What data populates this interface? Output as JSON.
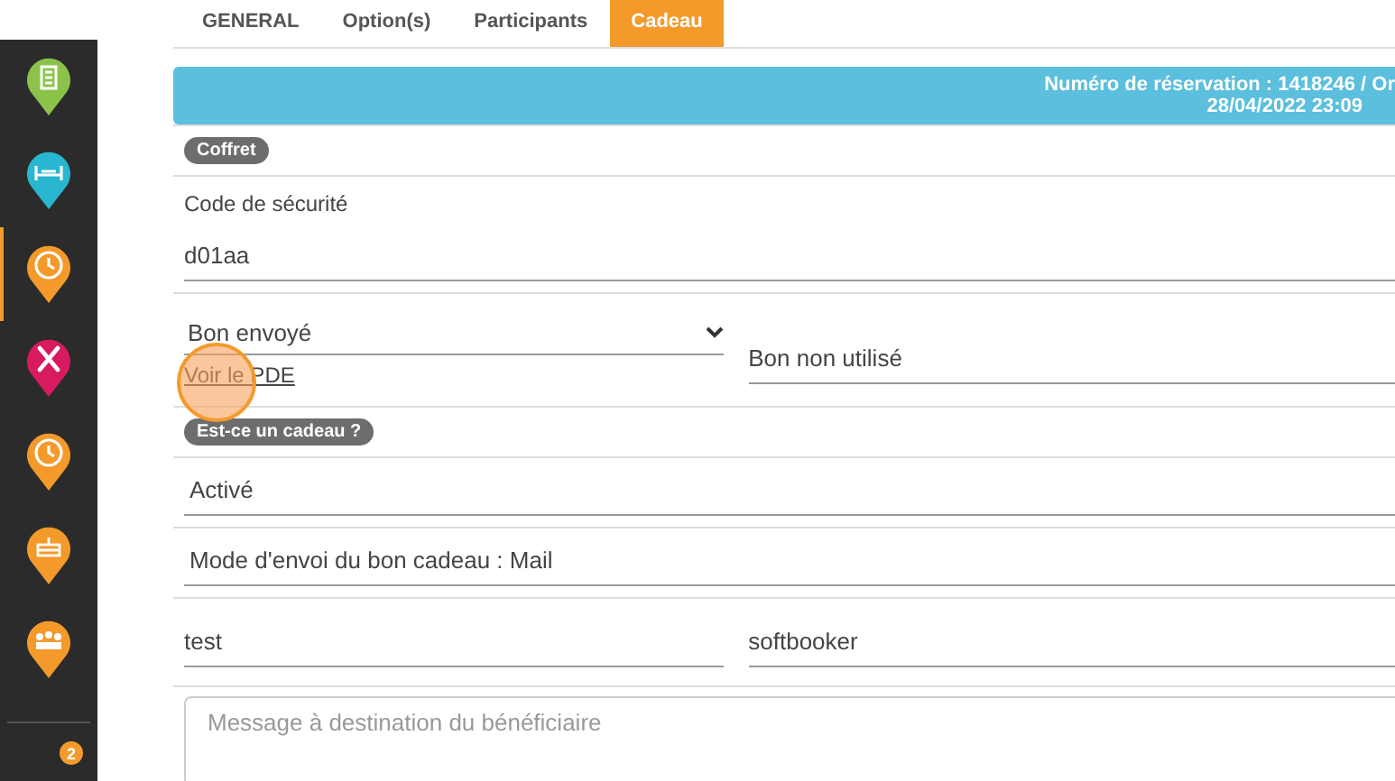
{
  "sidebar": {
    "items": [
      {
        "kind": "building",
        "color": "#8bc34a",
        "selected": false
      },
      {
        "kind": "bed",
        "color": "#29b6d0",
        "selected": false
      },
      {
        "kind": "clock",
        "color": "#f39a2b",
        "selected": true
      },
      {
        "kind": "cutlery",
        "color": "#d81b60",
        "selected": false
      },
      {
        "kind": "clock",
        "color": "#f39a2b",
        "selected": false
      },
      {
        "kind": "cake",
        "color": "#f39a2b",
        "selected": false
      },
      {
        "kind": "group",
        "color": "#f39a2b",
        "selected": false
      }
    ],
    "badge": "2"
  },
  "tabs": [
    {
      "label": "GENERAL",
      "selected": false
    },
    {
      "label": "Option(s)",
      "selected": false
    },
    {
      "label": "Participants",
      "selected": false
    },
    {
      "label": "Cadeau",
      "selected": true
    }
  ],
  "banner": {
    "line_1": "Numéro de réservation : 1418246 / Or",
    "line_2": "28/04/2022 23:09"
  },
  "coffret": {
    "tag": "Coffret",
    "security_label": "Code de sécurité",
    "security_value": "d01aa",
    "status_select": "Bon envoyé",
    "pdf_link": "Voir le PDE",
    "usage_value": "Bon non utilisé"
  },
  "gift": {
    "tag": "Est-ce un cadeau ?",
    "state_value": "Activé",
    "mode_value": "Mode d'envoi du bon cadeau : Mail",
    "field_1": "test",
    "field_2": "softbooker",
    "message_placeholder": "Message à destination du bénéficiaire"
  }
}
